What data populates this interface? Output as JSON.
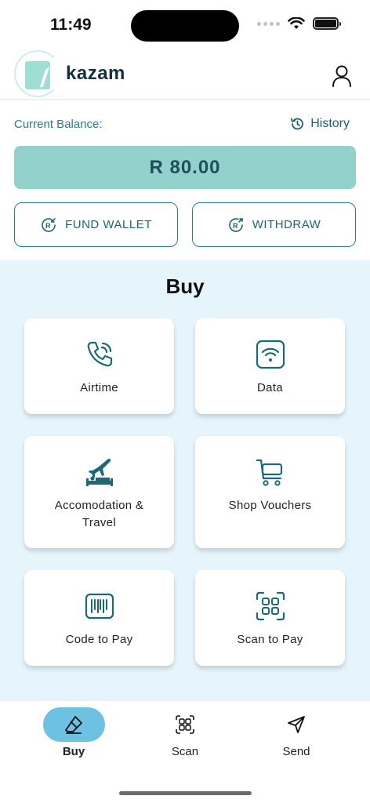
{
  "status_bar": {
    "time": "11:49"
  },
  "header": {
    "logo_text": "kazam"
  },
  "balance": {
    "label": "Current Balance:",
    "history_label": "History",
    "amount": "R 80.00"
  },
  "actions": {
    "fund_label": "FUND WALLET",
    "withdraw_label": "WITHDRAW"
  },
  "buy": {
    "title": "Buy",
    "tiles": [
      {
        "label": "Airtime",
        "icon": "phone-icon"
      },
      {
        "label": "Data",
        "icon": "wifi-icon"
      },
      {
        "label": "Accomodation &\nTravel",
        "icon": "travel-icon"
      },
      {
        "label": "Shop Vouchers",
        "icon": "cart-icon"
      },
      {
        "label": "Code to Pay",
        "icon": "barcode-icon"
      },
      {
        "label": "Scan to Pay",
        "icon": "qr-scan-icon"
      }
    ]
  },
  "nav": {
    "items": [
      {
        "label": "Buy",
        "icon": "eraser-icon",
        "active": true
      },
      {
        "label": "Scan",
        "icon": "qr-icon",
        "active": false
      },
      {
        "label": "Send",
        "icon": "send-icon",
        "active": false
      }
    ]
  },
  "colors": {
    "accent": "#93d2cc",
    "primary_text": "#1f6070",
    "section_bg": "#e6f4fc",
    "nav_active": "#6cc2e0"
  }
}
